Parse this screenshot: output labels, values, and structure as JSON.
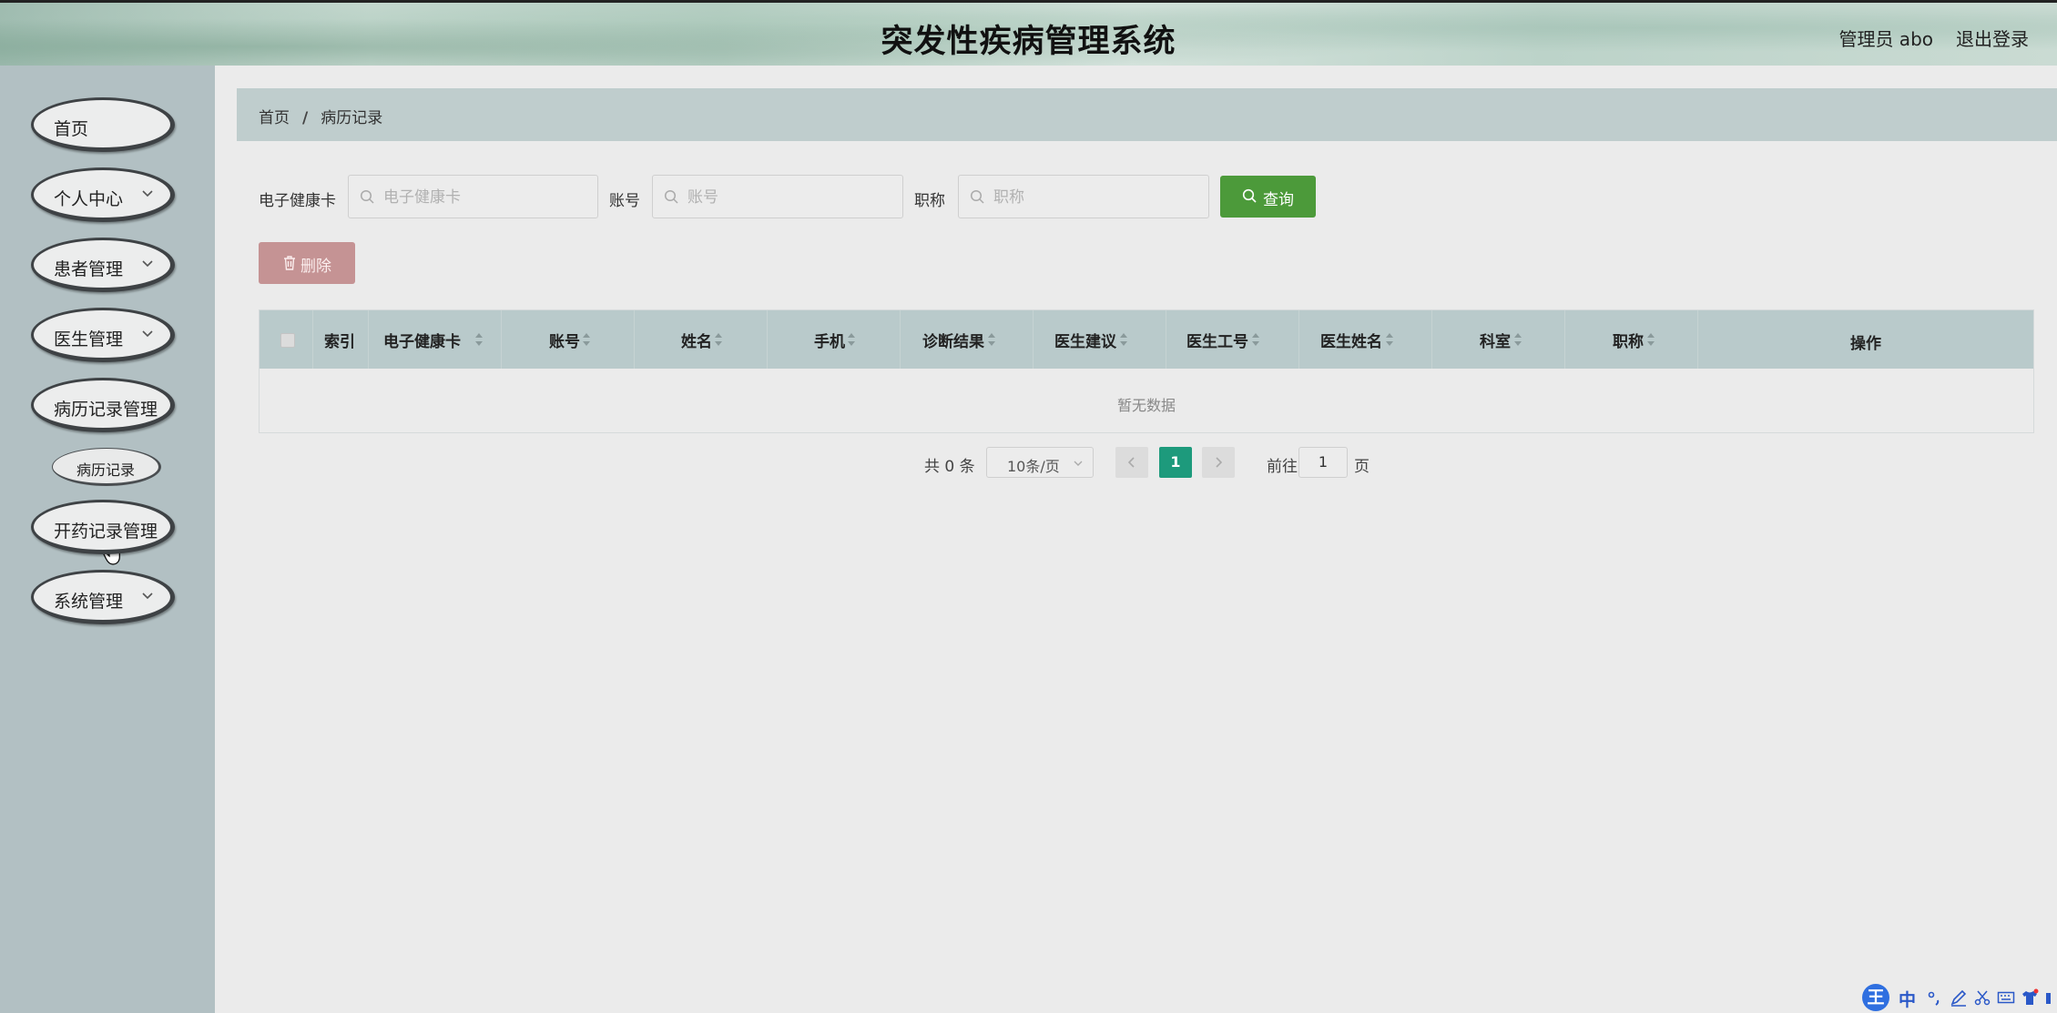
{
  "header": {
    "title": "突发性疾病管理系统",
    "user_label": "管理员 abo",
    "logout_label": "退出登录"
  },
  "sidebar": {
    "items": [
      {
        "label": "首页",
        "has_children": false
      },
      {
        "label": "个人中心",
        "has_children": true
      },
      {
        "label": "患者管理",
        "has_children": true
      },
      {
        "label": "医生管理",
        "has_children": true
      },
      {
        "label": "病历记录管理",
        "has_children": false
      },
      {
        "label": "开药记录管理",
        "has_children": false
      },
      {
        "label": "系统管理",
        "has_children": true
      }
    ],
    "submenu": {
      "label": "病历记录"
    }
  },
  "breadcrumb": {
    "home": "首页",
    "separator": "/",
    "current": "病历记录"
  },
  "search": {
    "card_label": "电子健康卡",
    "card_placeholder": "电子健康卡",
    "account_label": "账号",
    "account_placeholder": "账号",
    "title_label": "职称",
    "title_placeholder": "职称",
    "query_label": "查询"
  },
  "actions": {
    "delete_label": "删除"
  },
  "table": {
    "columns": [
      "索引",
      "电子健康卡",
      "账号",
      "姓名",
      "手机",
      "诊断结果",
      "医生建议",
      "医生工号",
      "医生姓名",
      "科室",
      "职称",
      "操作"
    ],
    "rows": [],
    "empty_text": "暂无数据"
  },
  "pagination": {
    "total_text": "共 0 条",
    "page_size": "10条/页",
    "current_page": "1",
    "goto_label": "前往",
    "goto_value": "1",
    "page_suffix": "页"
  },
  "ime": {
    "logo": "王",
    "mode": "中"
  },
  "colors": {
    "sidebar_bg": "#b2c0c3",
    "breadcrumb_bg": "#bfcdcd",
    "table_header_bg": "#b9cacb",
    "query_button": "#4c9a3a",
    "delete_button": "#c59394",
    "current_page": "#1d9a7c"
  }
}
